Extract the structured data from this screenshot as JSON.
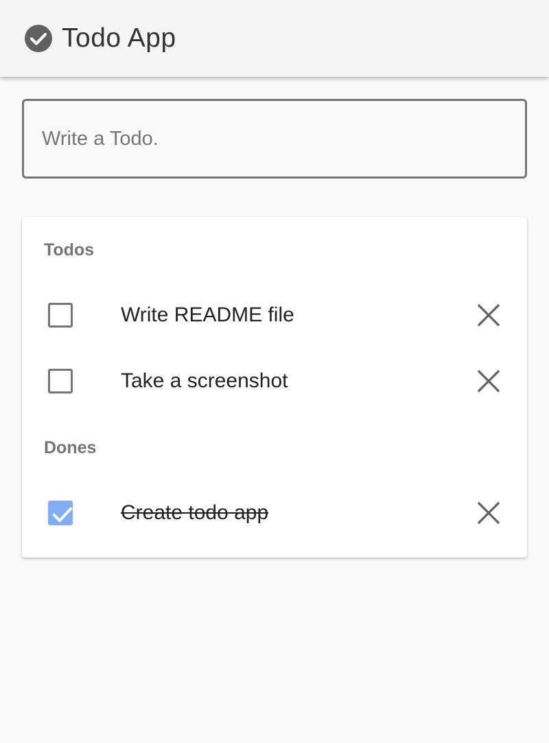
{
  "app": {
    "title": "Todo App",
    "logo_icon": "check-circle-icon"
  },
  "input": {
    "placeholder": "Write a Todo.",
    "value": ""
  },
  "sections": {
    "todos": {
      "header": "Todos",
      "items": [
        {
          "text": "Write README file",
          "checked": false
        },
        {
          "text": "Take a screenshot",
          "checked": false
        }
      ]
    },
    "dones": {
      "header": "Dones",
      "items": [
        {
          "text": "Create todo app",
          "checked": true
        }
      ]
    }
  },
  "colors": {
    "checked_checkbox": "#82aef8",
    "icon_gray": "#616161",
    "border_gray": "#757575"
  },
  "icons": {
    "delete": "close-icon",
    "checkbox_checked": "checkmark-icon"
  }
}
